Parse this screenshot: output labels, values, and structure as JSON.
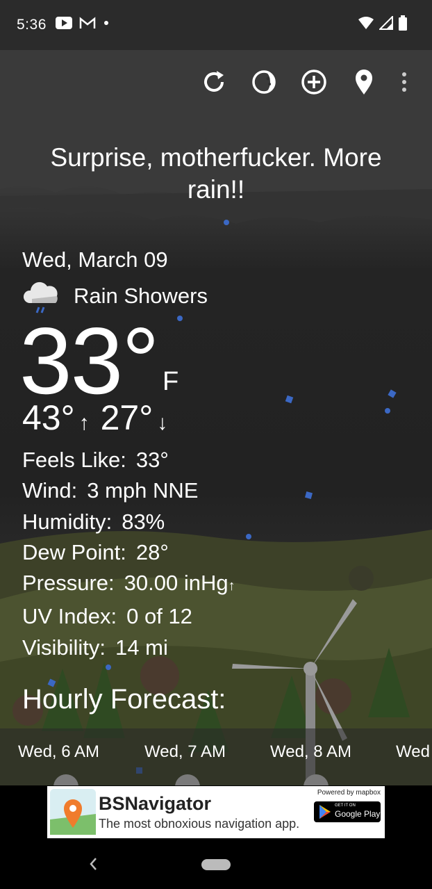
{
  "status_bar": {
    "time": "5:36",
    "left_icons": [
      "youtube-icon",
      "gmail-icon",
      "dot-icon"
    ],
    "right_icons": [
      "wifi-icon",
      "cell-signal-icon",
      "battery-icon"
    ]
  },
  "toolbar": {
    "icons": [
      "refresh-icon",
      "theme-icon",
      "add-location-icon",
      "location-pin-icon",
      "more-vert-icon"
    ]
  },
  "quote": "Surprise, motherfucker. More rain!!",
  "current": {
    "date": "Wed, March 09",
    "condition": "Rain Showers",
    "condition_icon": "rain-cloud-icon",
    "temperature": "33°",
    "unit": "F",
    "high": "43°",
    "high_arrow": "↑",
    "low": "27°",
    "low_arrow": "↓"
  },
  "details": {
    "feels_like": {
      "label": "Feels Like:",
      "value": "33°"
    },
    "wind": {
      "label": "Wind:",
      "value": "3 mph NNE"
    },
    "humidity": {
      "label": "Humidity:",
      "value": "83%"
    },
    "dew_point": {
      "label": "Dew Point:",
      "value": "28°"
    },
    "pressure": {
      "label": "Pressure:",
      "value": "30.00 inHg",
      "trend": "↑"
    },
    "uv_index": {
      "label": "UV Index:",
      "value": "0 of 12"
    },
    "visibility": {
      "label": "Visibility:",
      "value": "14 mi"
    }
  },
  "hourly": {
    "title": "Hourly Forecast:",
    "hours": [
      "Wed, 6 AM",
      "Wed, 7 AM",
      "Wed, 8 AM",
      "Wed"
    ]
  },
  "ad": {
    "title": "BSNavigator",
    "subtitle": "The most obnoxious navigation app.",
    "powered_by": "Powered by mapbox",
    "store_small": "GET IT ON",
    "store_big": "Google Play"
  },
  "colors": {
    "status_bar": "#2b2b2b",
    "sky": "#222222",
    "rain_drop": "#3b68c4",
    "ad_bg": "#ffffff"
  }
}
